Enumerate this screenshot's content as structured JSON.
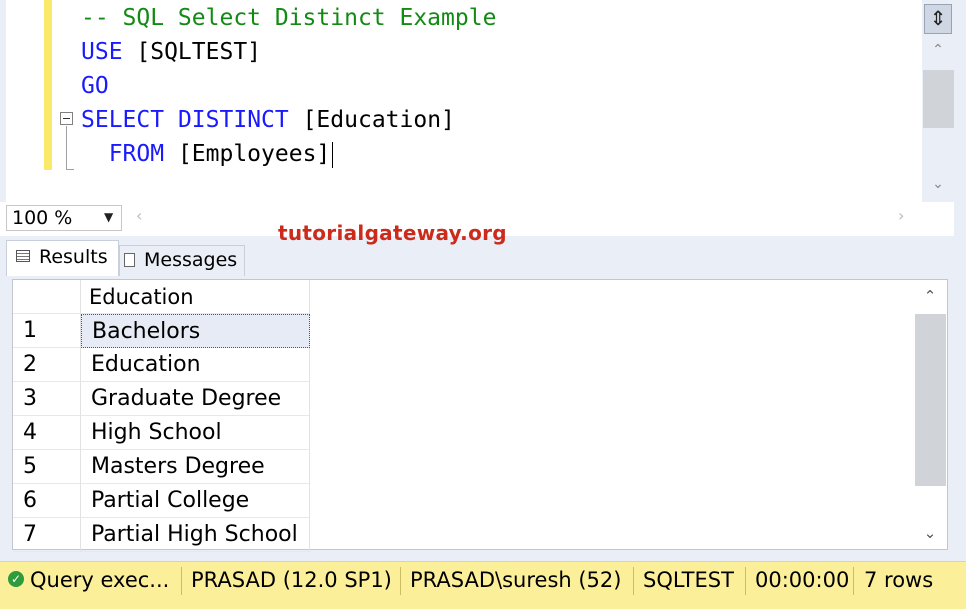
{
  "editor": {
    "lines": [
      {
        "parts": [
          {
            "t": "-- SQL Select Distinct Example",
            "c": "cm"
          }
        ]
      },
      {
        "parts": [
          {
            "t": "USE",
            "c": "kw"
          },
          {
            "t": " [SQLTEST]",
            "c": "tx"
          }
        ]
      },
      {
        "parts": [
          {
            "t": "GO",
            "c": "kw"
          }
        ]
      },
      {
        "parts": [
          {
            "t": "SELECT",
            "c": "kw"
          },
          {
            "t": " ",
            "c": "tx"
          },
          {
            "t": "DISTINCT",
            "c": "kw"
          },
          {
            "t": " [Education]",
            "c": "tx"
          }
        ]
      },
      {
        "parts": [
          {
            "t": "  ",
            "c": "tx"
          },
          {
            "t": "FROM",
            "c": "kw"
          },
          {
            "t": " [Employees]",
            "c": "tx"
          }
        ]
      }
    ]
  },
  "zoom": {
    "value": "100 %"
  },
  "tabs": {
    "results": "Results",
    "messages": "Messages"
  },
  "brand": "tutorialgateway.org",
  "grid": {
    "column": "Education",
    "rows": [
      {
        "n": "1",
        "v": "Bachelors"
      },
      {
        "n": "2",
        "v": "Education"
      },
      {
        "n": "3",
        "v": "Graduate Degree"
      },
      {
        "n": "4",
        "v": "High School"
      },
      {
        "n": "5",
        "v": "Masters Degree"
      },
      {
        "n": "6",
        "v": "Partial College"
      },
      {
        "n": "7",
        "v": "Partial High School"
      }
    ]
  },
  "status": {
    "query": "Query exec...",
    "server": "PRASAD (12.0 SP1)",
    "user": "PRASAD\\suresh (52)",
    "database": "SQLTEST",
    "time": "00:00:00",
    "rows": "7 rows"
  },
  "colors": {
    "keyword": "#1a1aff",
    "comment": "#138a13",
    "status_bar": "#fcef9a",
    "brand": "#cc2a1a"
  }
}
